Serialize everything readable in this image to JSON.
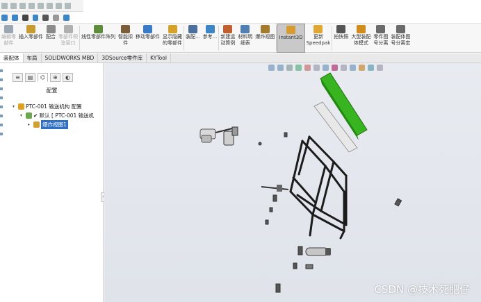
{
  "commands": [
    {
      "id": "edit-component",
      "label": "编辑零\n部件",
      "dim": true,
      "color": "#9aa6b2"
    },
    {
      "id": "insert-component",
      "label": "插入零部件",
      "dim": false,
      "color": "#c79b30"
    },
    {
      "id": "mate",
      "label": "配合",
      "dim": false,
      "color": "#8a8a8a"
    },
    {
      "id": "component-preview",
      "label": "零部件预\n览窗口",
      "dim": true,
      "color": "#b0b0b0"
    },
    {
      "id": "linear-pattern",
      "label": "线性零部件阵列",
      "dim": false,
      "color": "#5d8d3b"
    },
    {
      "id": "smart-fastener",
      "label": "智能扣\n件",
      "dim": false,
      "color": "#7b5d3a"
    },
    {
      "id": "move-component",
      "label": "移动零部件",
      "dim": false,
      "color": "#3a7bc8"
    },
    {
      "id": "show-hidden",
      "label": "显示隐藏\n的零部件",
      "dim": false,
      "color": "#d3a32a"
    },
    {
      "id": "assembly-features",
      "label": "装配...",
      "dim": false,
      "color": "#4c6f9e"
    },
    {
      "id": "reference",
      "label": "参考...",
      "dim": false,
      "color": "#3c86c8"
    },
    {
      "id": "new-motion-study",
      "label": "新建运\n动算例",
      "dim": false,
      "color": "#c06030"
    },
    {
      "id": "bom",
      "label": "材料明\n细表",
      "dim": false,
      "color": "#4f7fb3"
    },
    {
      "id": "exploded-view",
      "label": "爆炸视图",
      "dim": false,
      "color": "#a47a2d"
    },
    {
      "id": "instant3d",
      "label": "Instant3D",
      "dim": false,
      "color": "#d89b2f",
      "active": true
    },
    {
      "id": "update-speedpak",
      "label": "更新\nSpeedpak",
      "dim": false,
      "color": "#e0a732"
    },
    {
      "id": "snapshot",
      "label": "拍快照",
      "dim": false,
      "color": "#555"
    },
    {
      "id": "large-assembly",
      "label": "大型装配\n体模式",
      "dim": false,
      "color": "#d18d1c"
    },
    {
      "id": "part-separation",
      "label": "零件图\n号分离",
      "dim": false,
      "color": "#6b6b6b"
    },
    {
      "id": "assembly-separation",
      "label": "装配体图\n号分离宏",
      "dim": false,
      "color": "#6b6b6b"
    }
  ],
  "tabs": [
    "装配体",
    "布局",
    "SOLIDWORKS MBD",
    "3DSource零件库",
    "KYTool"
  ],
  "active_tab": 0,
  "panel": {
    "tab_icons": [
      "feature-manager-icon",
      "property-manager-icon",
      "configuration-manager-icon",
      "dimxpert-icon",
      "display-manager-icon"
    ],
    "title": "配置",
    "tree": [
      {
        "level": 0,
        "twist": "▾",
        "text": "PTC-001 输送机构 配置",
        "icon": "#e0a020",
        "selected": false
      },
      {
        "level": 1,
        "twist": "▾",
        "text": "✔ 默认 [ PTC-001 输送机",
        "icon": "#6aa84f",
        "selected": false
      },
      {
        "level": 2,
        "twist": "▸",
        "text": "爆炸视图1",
        "icon": "#d0a030",
        "selected": true
      }
    ]
  },
  "headsup_colors": [
    "#8aa7c6",
    "#8aa7c6",
    "#9aa",
    "#7b9",
    "#c88",
    "#aab",
    "#8aa7c6",
    "#b58",
    "#aab",
    "#8aa7c6",
    "#c95",
    "#7ab",
    "#aab"
  ],
  "model": {
    "accent_color": "#37b41f",
    "frame_color": "#1c1c1c"
  },
  "watermark": "CSDN @技术死肥仔"
}
